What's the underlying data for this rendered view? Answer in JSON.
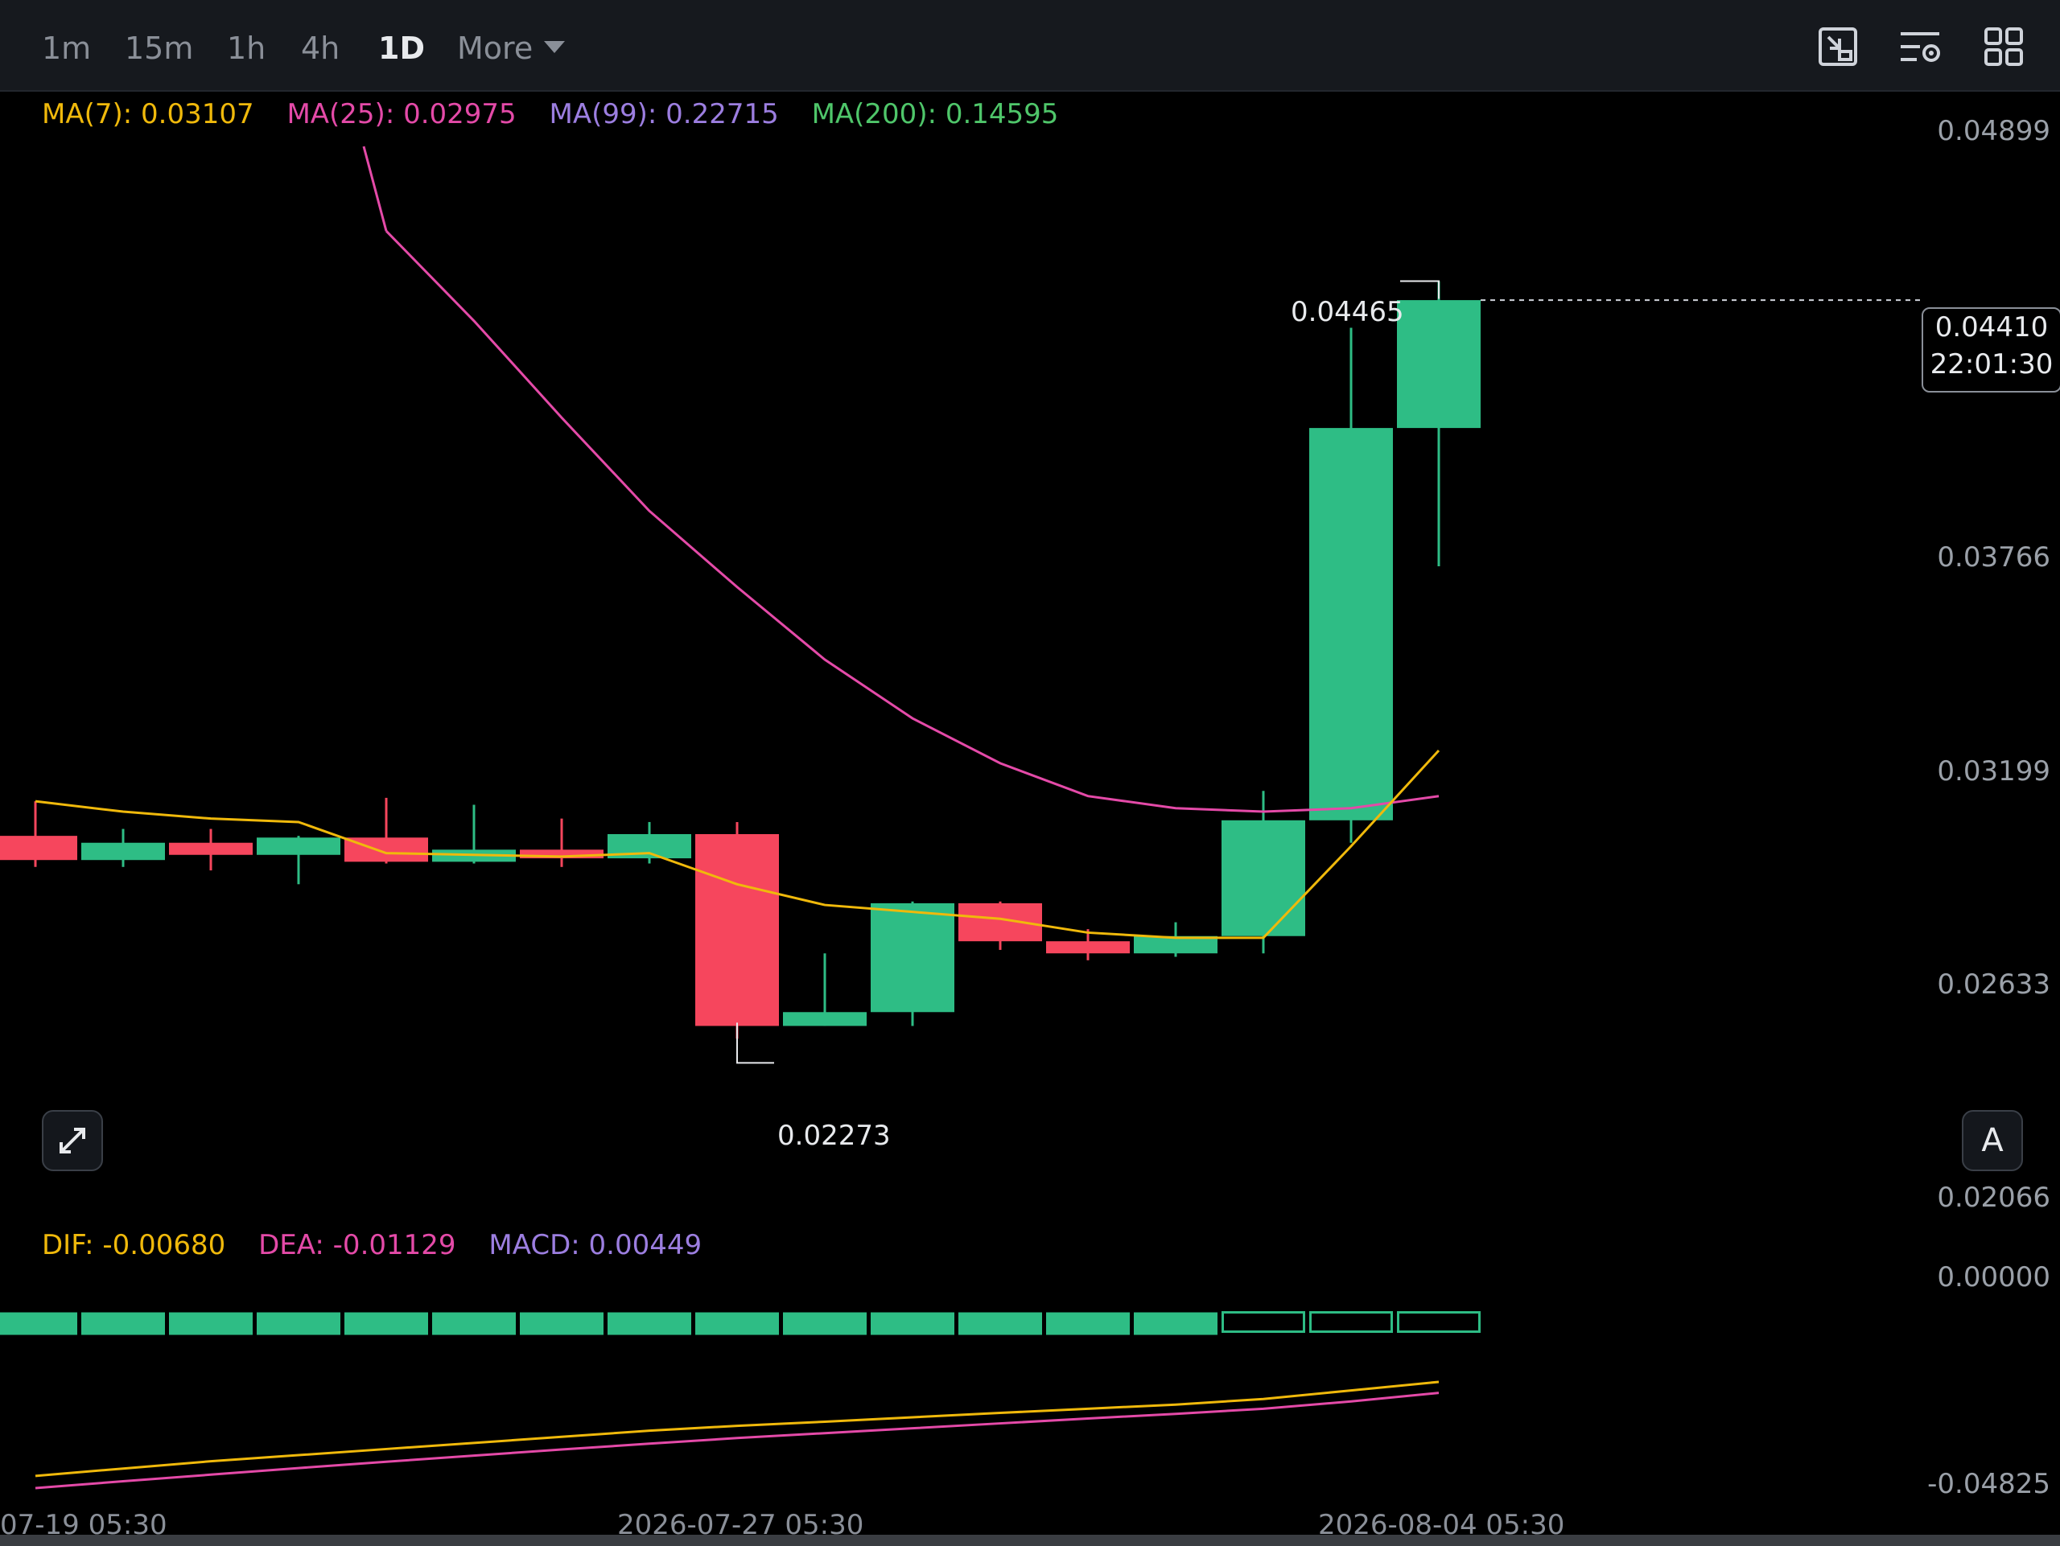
{
  "toolbar": {
    "timeframes": [
      "1m",
      "15m",
      "1h",
      "4h",
      "1D"
    ],
    "active_timeframe": "1D",
    "more_label": "More",
    "icons": [
      "screenshot-icon",
      "chart-settings-icon",
      "layout-grid-icon"
    ]
  },
  "ma_legend": {
    "ma7": "MA(7): 0.03107",
    "ma25": "MA(25): 0.02975",
    "ma99": "MA(99): 0.22715",
    "ma200": "MA(200): 0.14595"
  },
  "macd_legend": {
    "dif": "DIF: -0.00680",
    "dea": "DEA: -0.01129",
    "macd": "MACD: 0.00449"
  },
  "price_axis": [
    "0.04899",
    "0.03766",
    "0.03199",
    "0.02633",
    "0.02066"
  ],
  "macd_axis": [
    "0.00000",
    "-0.04825"
  ],
  "dates": [
    "07-19 05:30",
    "2026-07-27 05:30",
    "2026-08-04 05:30"
  ],
  "high_annotation": "0.04465",
  "low_annotation": "0.02273",
  "current_price": "0.04410",
  "countdown": "22:01:30",
  "auto_label": "A",
  "colors": {
    "up": "#2ebd85",
    "down": "#f6465d",
    "ma7": "#f0b90b",
    "ma25": "#e44aa8",
    "ma99": "#9c7ee0",
    "ma200": "#4fc66a",
    "background": "#000000"
  },
  "chart_data": {
    "type": "candlestick",
    "candles": [
      {
        "open": 0.0286,
        "high": 0.0296,
        "low": 0.0277,
        "close": 0.0279
      },
      {
        "open": 0.0279,
        "high": 0.0288,
        "low": 0.0277,
        "close": 0.0284
      },
      {
        "open": 0.0284,
        "high": 0.0288,
        "low": 0.0276,
        "close": 0.02805
      },
      {
        "open": 0.02805,
        "high": 0.0286,
        "low": 0.0272,
        "close": 0.02855
      },
      {
        "open": 0.02855,
        "high": 0.0297,
        "low": 0.0278,
        "close": 0.02785
      },
      {
        "open": 0.02785,
        "high": 0.0295,
        "low": 0.0278,
        "close": 0.0282
      },
      {
        "open": 0.0282,
        "high": 0.0291,
        "low": 0.0277,
        "close": 0.02795
      },
      {
        "open": 0.02795,
        "high": 0.029,
        "low": 0.0278,
        "close": 0.02865
      },
      {
        "open": 0.02865,
        "high": 0.029,
        "low": 0.02273,
        "close": 0.0231
      },
      {
        "open": 0.0231,
        "high": 0.0252,
        "low": 0.0231,
        "close": 0.0235
      },
      {
        "open": 0.0235,
        "high": 0.0267,
        "low": 0.0231,
        "close": 0.02665
      },
      {
        "open": 0.02665,
        "high": 0.0267,
        "low": 0.0253,
        "close": 0.02555
      },
      {
        "open": 0.02555,
        "high": 0.0259,
        "low": 0.025,
        "close": 0.0252
      },
      {
        "open": 0.0252,
        "high": 0.0261,
        "low": 0.0251,
        "close": 0.0257
      },
      {
        "open": 0.0257,
        "high": 0.0299,
        "low": 0.0252,
        "close": 0.02905
      },
      {
        "open": 0.02905,
        "high": 0.0433,
        "low": 0.0284,
        "close": 0.0404
      },
      {
        "open": 0.0404,
        "high": 0.04465,
        "low": 0.0364,
        "close": 0.0441
      }
    ],
    "ma7": [
      0.0296,
      0.0293,
      0.0291,
      0.029,
      0.0281,
      0.02805,
      0.028,
      0.0281,
      0.0272,
      0.0266,
      0.0264,
      0.0262,
      0.0258,
      0.02565,
      0.02565,
      0.0283,
      0.03107
    ],
    "ma25": [
      null,
      null,
      null,
      null,
      0.0461,
      0.0435,
      0.0407,
      0.038,
      0.0358,
      0.0337,
      0.032,
      0.0307,
      0.02975,
      0.0294,
      0.0293,
      0.0294,
      0.02975
    ],
    "macd_hist": [
      -0.007,
      -0.0069,
      -0.0068,
      -0.0067,
      -0.0066,
      -0.0064,
      -0.0062,
      -0.006,
      -0.0058,
      -0.0055,
      -0.0052,
      -0.0049,
      -0.0045,
      -0.004,
      0.0025,
      0.0035,
      0.00449
    ],
    "dif": [
      -0.065,
      -0.062,
      -0.059,
      -0.0565,
      -0.054,
      -0.0515,
      -0.049,
      -0.0465,
      -0.0445,
      -0.0428,
      -0.041,
      -0.0392,
      -0.0375,
      -0.0358,
      -0.0335,
      -0.03,
      -0.0265
    ],
    "dea": [
      -0.07,
      -0.0672,
      -0.0645,
      -0.0618,
      -0.0592,
      -0.0567,
      -0.0542,
      -0.0518,
      -0.0495,
      -0.0475,
      -0.0455,
      -0.0435,
      -0.0415,
      -0.0396,
      -0.0375,
      -0.0345,
      -0.031
    ],
    "price_range": [
      0.0182,
      0.04899
    ],
    "macd_range": [
      -0.07,
      0.015
    ]
  }
}
